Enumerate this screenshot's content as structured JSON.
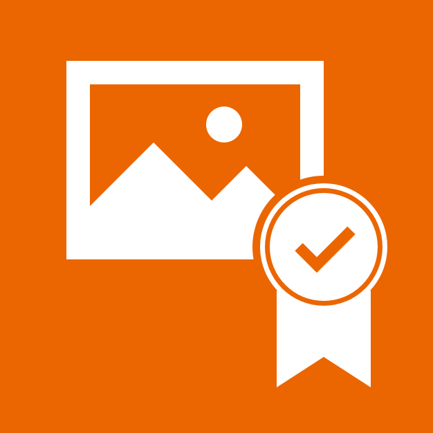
{
  "colors": {
    "background": "#EB6600",
    "foreground": "#FFFFFF"
  },
  "icon": {
    "name": "certified-image-icon",
    "parts": [
      "image-frame-icon",
      "sun-icon",
      "mountains-icon",
      "award-badge-icon",
      "checkmark-icon",
      "ribbon-icon"
    ]
  }
}
